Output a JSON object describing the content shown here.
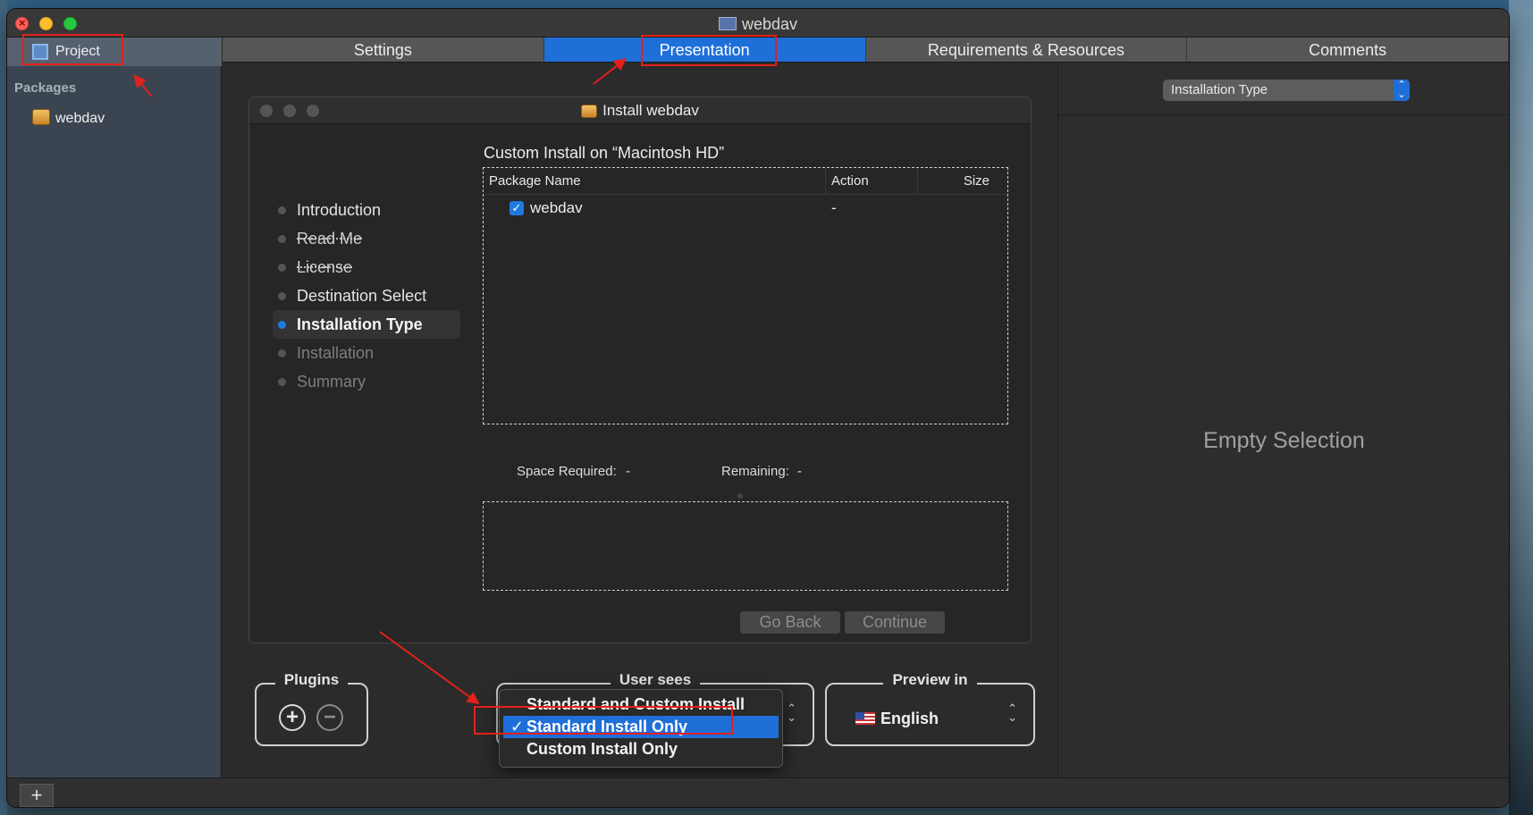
{
  "window": {
    "title": "webdav"
  },
  "sidebar": {
    "project_label": "Project",
    "section_label": "Packages",
    "packages": [
      {
        "label": "webdav"
      }
    ]
  },
  "tabs": [
    {
      "label": "Settings",
      "active": false
    },
    {
      "label": "Presentation",
      "active": true
    },
    {
      "label": "Requirements & Resources",
      "active": false
    },
    {
      "label": "Comments",
      "active": false
    }
  ],
  "installer": {
    "title": "Install webdav",
    "steps": [
      {
        "label": "Introduction",
        "state": "normal"
      },
      {
        "label": "Read Me",
        "state": "struck"
      },
      {
        "label": "License",
        "state": "struck"
      },
      {
        "label": "Destination Select",
        "state": "normal"
      },
      {
        "label": "Installation Type",
        "state": "current"
      },
      {
        "label": "Installation",
        "state": "dim"
      },
      {
        "label": "Summary",
        "state": "dim"
      }
    ],
    "custom_install_title": "Custom Install on “Macintosh HD”",
    "table": {
      "headers": {
        "name": "Package Name",
        "action": "Action",
        "size": "Size"
      },
      "rows": [
        {
          "checked": true,
          "name": "webdav",
          "action": "-",
          "size": ""
        }
      ]
    },
    "space_required_label": "Space Required:",
    "space_required_value": "-",
    "remaining_label": "Remaining:",
    "remaining_value": "-",
    "go_back_label": "Go Back",
    "continue_label": "Continue"
  },
  "bottom": {
    "plugins_label": "Plugins",
    "add_symbol": "+",
    "remove_symbol": "−",
    "user_sees_label": "User sees",
    "preview_label": "Preview in",
    "preview_value": "English"
  },
  "user_sees_menu": {
    "options": [
      {
        "label": "Standard and Custom Install",
        "selected": false
      },
      {
        "label": "Standard Install Only",
        "selected": true
      },
      {
        "label": "Custom Install Only",
        "selected": false
      }
    ],
    "check_glyph": "✓"
  },
  "inspector": {
    "select_value": "Installation Type",
    "empty_text": "Empty Selection"
  },
  "footer": {
    "add_symbol": "+"
  },
  "colors": {
    "accent": "#1f6fd8",
    "annotation": "#e3201a"
  }
}
